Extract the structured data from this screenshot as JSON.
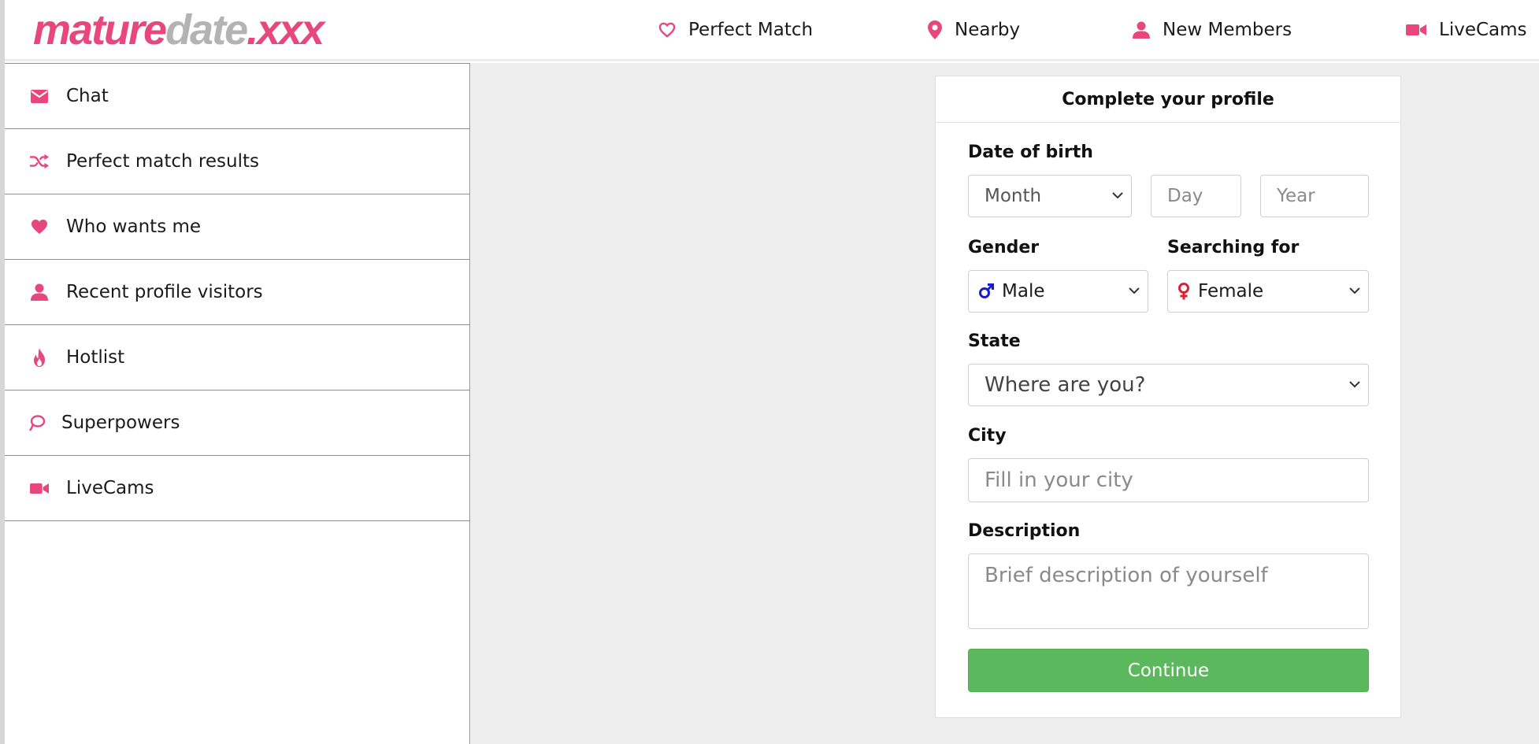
{
  "brand": {
    "logo_part1": "mature",
    "logo_part2": "date",
    "logo_part3": ".xxx",
    "accent_color": "#e8477c"
  },
  "topnav": [
    {
      "label": "Perfect Match",
      "icon": "heart-outline-icon"
    },
    {
      "label": "Nearby",
      "icon": "map-pin-icon"
    },
    {
      "label": "New Members",
      "icon": "user-icon"
    },
    {
      "label": "LiveCams",
      "icon": "video-camera-icon"
    }
  ],
  "sidebar": {
    "items": [
      {
        "label": "Chat",
        "icon": "envelope-icon"
      },
      {
        "label": "Perfect match results",
        "icon": "shuffle-icon"
      },
      {
        "label": "Who wants me",
        "icon": "heart-icon"
      },
      {
        "label": "Recent profile visitors",
        "icon": "user-icon"
      },
      {
        "label": "Hotlist",
        "icon": "fire-icon"
      },
      {
        "label": "Superpowers",
        "icon": "lasso-icon"
      },
      {
        "label": "LiveCams",
        "icon": "video-camera-icon"
      }
    ]
  },
  "profile_form": {
    "title": "Complete your profile",
    "dob_label": "Date of birth",
    "month_placeholder": "Month",
    "day_placeholder": "Day",
    "year_placeholder": "Year",
    "gender_label": "Gender",
    "gender_value": "Male",
    "searching_label": "Searching for",
    "searching_value": "Female",
    "state_label": "State",
    "state_placeholder": "Where are you?",
    "city_label": "City",
    "city_placeholder": "Fill in your city",
    "description_label": "Description",
    "description_placeholder": "Brief description of yourself",
    "continue_label": "Continue",
    "continue_color": "#5cb85c",
    "male_color": "#1a1ad6",
    "female_color": "#e0202e"
  }
}
